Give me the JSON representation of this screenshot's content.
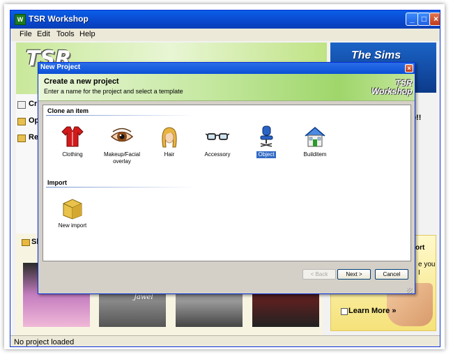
{
  "window": {
    "title": "TSR Workshop",
    "icon_label": "W",
    "minimize": "_",
    "maximize": "□",
    "close": "×"
  },
  "menu": [
    {
      "label": "File"
    },
    {
      "label": "Edit"
    },
    {
      "label": "Tools"
    },
    {
      "label": "Help"
    }
  ],
  "background": {
    "banner_logo": "TSR",
    "sims_logo": "The Sims",
    "left_links": [
      "Cr",
      "Op",
      "Rec"
    ],
    "side_text": "e!!",
    "side_text2": "ort",
    "side_text3": "e you",
    "side_text4": "I",
    "thumbs_label": "Sho",
    "learn_more": "Learn More »",
    "thumb_captions": [
      "",
      "Jawel",
      "",
      ""
    ]
  },
  "status": {
    "text": "No project loaded"
  },
  "dialog": {
    "title": "New Project",
    "close": "×",
    "heading": "Create a new project",
    "subheading": "Enter a name for the project and select a template",
    "logo_line1": "TSR",
    "logo_line2": "Workshop",
    "groups": [
      {
        "label": "Clone an item",
        "items": [
          {
            "label": "Clothing",
            "icon": "shirt-icon"
          },
          {
            "label": "Makeup/Facial overlay",
            "icon": "eye-icon"
          },
          {
            "label": "Hair",
            "icon": "hair-icon"
          },
          {
            "label": "Accessory",
            "icon": "glasses-icon"
          },
          {
            "label": "Object",
            "icon": "chair-icon",
            "selected": true
          },
          {
            "label": "Builditem",
            "icon": "house-icon"
          }
        ]
      },
      {
        "label": "Import",
        "items": [
          {
            "label": "New import",
            "icon": "box-icon"
          }
        ]
      }
    ],
    "buttons": {
      "back": "< Back",
      "next": "Next >",
      "cancel": "Cancel"
    }
  },
  "colors": {
    "title_blue": "#0a4fd6",
    "selection_blue": "#316ac5",
    "header_green": "#9fd66a"
  }
}
